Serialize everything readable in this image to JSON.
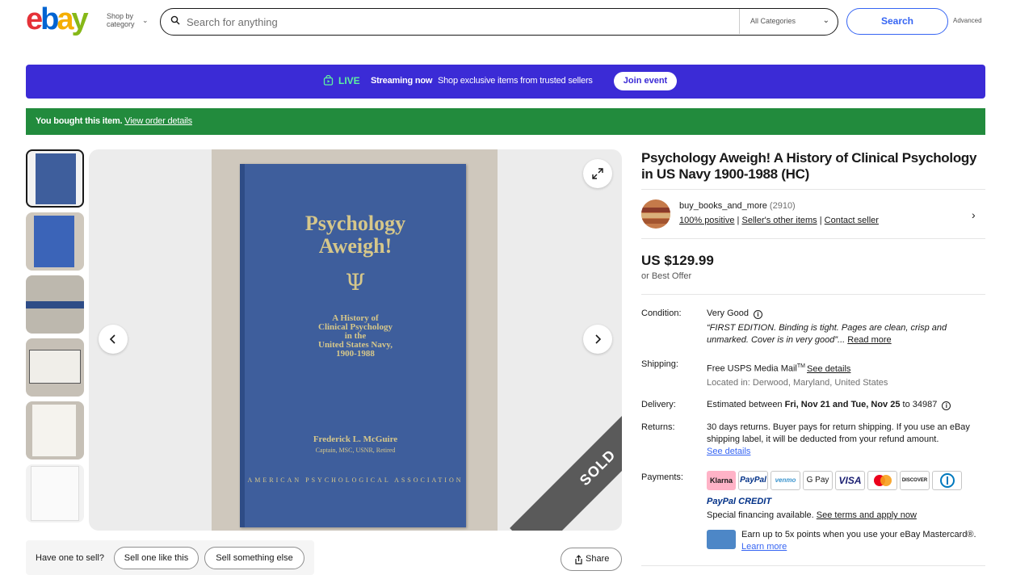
{
  "header": {
    "logo_letters": [
      "e",
      "b",
      "a",
      "y"
    ],
    "logo_colors": [
      "#e53238",
      "#0064d2",
      "#f5af02",
      "#86b817"
    ],
    "shop_by_line1": "Shop by",
    "shop_by_line2": "category",
    "search_placeholder": "Search for anything",
    "category": "All Categories",
    "search_button": "Search",
    "advanced": "Advanced"
  },
  "live_banner": {
    "live": "LIVE",
    "streaming": "Streaming now",
    "message": "Shop exclusive items from trusted sellers",
    "join_button": "Join event"
  },
  "purchase_notice": {
    "text": "You bought this item.",
    "link": "View order details"
  },
  "gallery": {
    "thumbnails": [
      "thumbnail-1",
      "thumbnail-2",
      "thumbnail-3",
      "thumbnail-4",
      "thumbnail-5",
      "thumbnail-6"
    ],
    "book_title": "Psychology Aweigh!",
    "book_symbol": "Ψ",
    "book_subtitle_lines": [
      "A History of",
      "Clinical Psychology",
      "in the",
      "United States Navy,",
      "1900-1988"
    ],
    "book_author": "Frederick L. McGuire",
    "book_author_credentials": "Captain, MSC, USNR, Retired",
    "book_publisher": "AMERICAN PSYCHOLOGICAL ASSOCIATION",
    "sold_label": "SOLD"
  },
  "sell": {
    "label": "Have one to sell?",
    "sell_one": "Sell one like this",
    "sell_else": "Sell something else"
  },
  "share": "Share",
  "item": {
    "title": "Psychology Aweigh! A History of Clinical Psychology in US Navy 1900-1988 (HC)",
    "seller_name": "buy_books_and_more",
    "seller_feedback": "(2910)",
    "positive": "100% positive",
    "other_items": "Seller's other items",
    "contact": "Contact seller",
    "price": "US $129.99",
    "best_offer": "or Best Offer"
  },
  "details": {
    "condition_label": "Condition:",
    "condition_value": "Very Good",
    "condition_desc": "“FIRST EDITION. Binding is tight. Pages are clean, crisp and unmarked. Cover is in very good”...",
    "read_more": "Read more",
    "shipping_label": "Shipping:",
    "shipping_value": "Free USPS Media Mail",
    "shipping_tm": "TM",
    "shipping_link": "See details",
    "location": "Located in: Derwood, Maryland, United States",
    "delivery_label": "Delivery:",
    "delivery_prefix": "Estimated between",
    "delivery_dates": "Fri, Nov 21 and Tue, Nov 25",
    "delivery_suffix": "to 34987",
    "returns_label": "Returns:",
    "returns_text": "30 days returns. Buyer pays for return shipping. If you use an eBay shipping label, it will be deducted from your refund amount.",
    "returns_link": "See details",
    "payments_label": "Payments:",
    "payment_methods": [
      "Klarna",
      "PayPal",
      "venmo",
      "G Pay",
      "VISA",
      "Mastercard",
      "DISCOVER",
      "Diners Club"
    ],
    "paypal_credit": "PayPal CREDIT",
    "financing": "Special financing available.",
    "financing_link": "See terms and apply now",
    "mastercard_promo": "Earn up to 5x points when you use your eBay Mastercard®.",
    "learn_more": "Learn more"
  }
}
